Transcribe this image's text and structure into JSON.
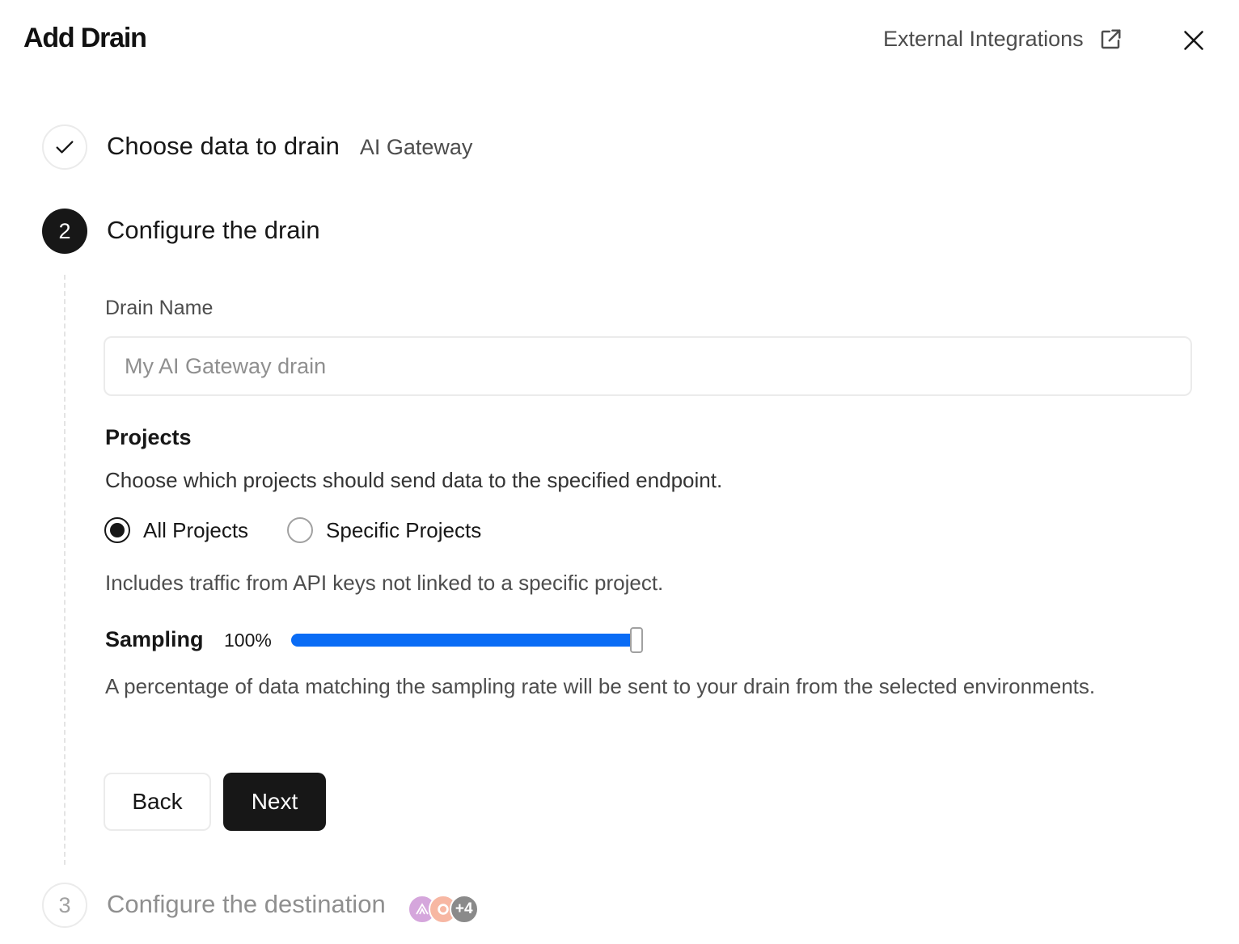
{
  "header": {
    "title": "Add Drain",
    "external_link_label": "External Integrations",
    "external_icon": "external-link-icon",
    "close_icon": "close-icon"
  },
  "steps": [
    {
      "number": "1",
      "state": "done",
      "title": "Choose data to drain",
      "subtitle": "AI Gateway",
      "icon": "check-icon"
    },
    {
      "number": "2",
      "state": "active",
      "title": "Configure the drain"
    },
    {
      "number": "3",
      "state": "pending",
      "title": "Configure the destination",
      "more_count": "+4"
    }
  ],
  "form": {
    "drain_name_label": "Drain Name",
    "drain_name_placeholder": "My AI Gateway drain",
    "drain_name_value": "",
    "projects_title": "Projects",
    "projects_description": "Choose which projects should send data to the specified endpoint.",
    "radio_options": [
      {
        "label": "All Projects",
        "checked": true
      },
      {
        "label": "Specific Projects",
        "checked": false
      }
    ],
    "projects_note": "Includes traffic from API keys not linked to a specific project.",
    "sampling_label": "Sampling",
    "sampling_value_text": "100%",
    "sampling_fraction": 1.0,
    "sampling_description": "A percentage of data matching the sampling rate will be sent to your drain from the selected environments.",
    "back_label": "Back",
    "next_label": "Next"
  },
  "colors": {
    "accent": "#0a6cf5",
    "primary": "#171717"
  }
}
